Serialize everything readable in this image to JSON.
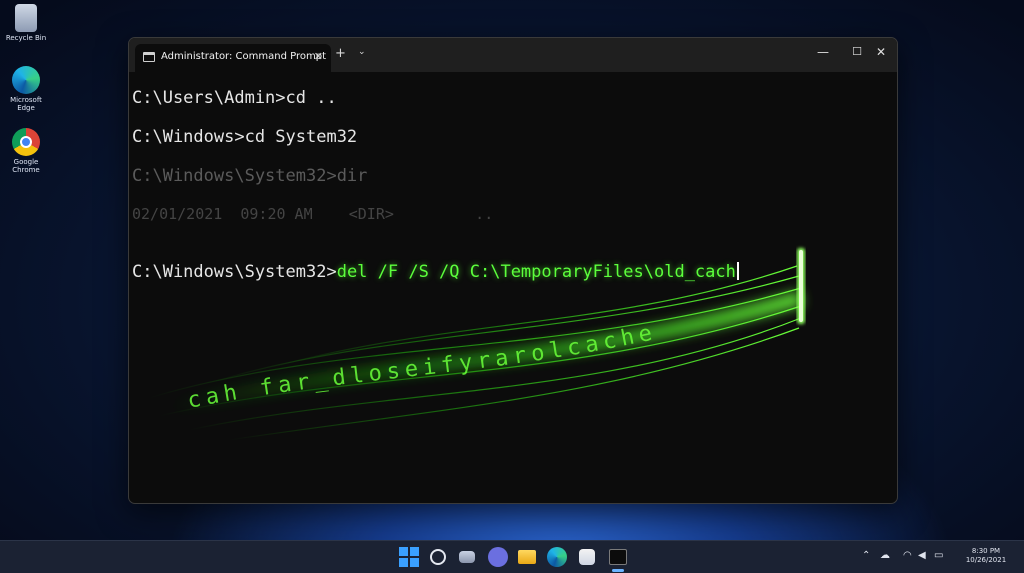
{
  "desktop": {
    "icons": [
      {
        "label": "Recycle Bin",
        "icon": "recycle-bin-icon"
      },
      {
        "label": "Microsoft Edge",
        "icon": "edge-icon"
      },
      {
        "label": "Google Chrome",
        "icon": "chrome-icon"
      }
    ]
  },
  "window": {
    "tab_title": "Administrator: Command Prompt",
    "new_tab": "+",
    "tab_dropdown": "⌄",
    "minimize": "—",
    "maximize": "☐",
    "close": "✕",
    "tab_close": "✕"
  },
  "console": {
    "lines": [
      "C:\\Users\\Admin>cd ..",
      "C:\\Windows>cd System32",
      "C:\\Windows\\System32>dir",
      "02/01/2021  09:20 AM    <DIR>         .."
    ],
    "prompt": "C:\\Windows\\System32>",
    "command": "del /F /S /Q C:\\TemporaryFiles\\old_cach",
    "flying_text": "cah far_dloseifyrarolcache"
  },
  "taskbar": {
    "clock_time": "8:30 PM",
    "clock_date": "10/26/2021"
  },
  "colors": {
    "accent_green": "#5cff3c",
    "console_bg": "#0c0c0c"
  }
}
